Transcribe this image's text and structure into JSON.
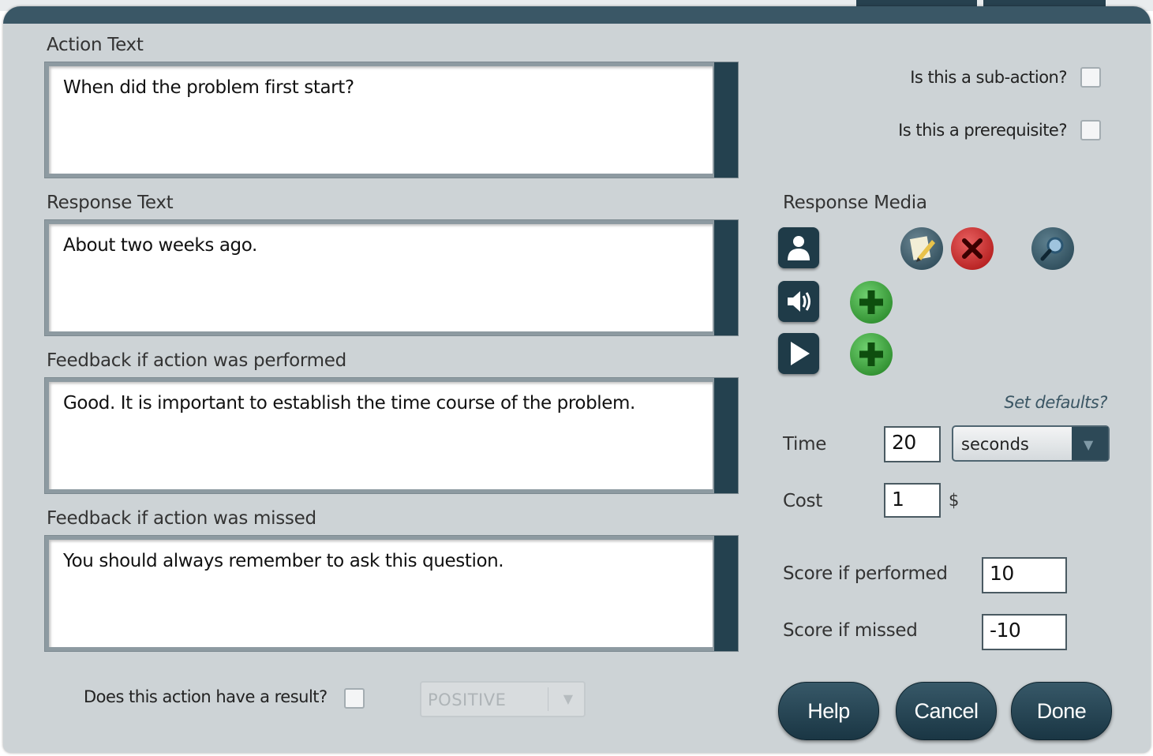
{
  "fields": {
    "action_text": {
      "label": "Action Text",
      "value": "When did the problem first start?"
    },
    "response_text": {
      "label": "Response Text",
      "value": "About two weeks ago."
    },
    "feedback_performed": {
      "label": "Feedback if action was performed",
      "value": "Good. It is important to establish the time course of the problem."
    },
    "feedback_missed": {
      "label": "Feedback if action was missed",
      "value": "You should always remember to ask this question."
    }
  },
  "options": {
    "sub_action": {
      "label": "Is this a sub-action?",
      "checked": false
    },
    "prerequisite": {
      "label": "Is this a prerequisite?",
      "checked": false
    },
    "has_result": {
      "label": "Does this action have a result?",
      "checked": false
    },
    "result_select": {
      "value": "POSITIVE",
      "disabled": true
    }
  },
  "media": {
    "label": "Response Media",
    "rows": [
      {
        "type": "person-icon",
        "actions": [
          "edit-icon",
          "delete-icon",
          "view-icon"
        ]
      },
      {
        "type": "speaker-icon",
        "actions": [
          "add-icon"
        ]
      },
      {
        "type": "play-icon",
        "actions": [
          "add-icon"
        ]
      }
    ]
  },
  "settings": {
    "set_defaults": "Set defaults?",
    "time": {
      "label": "Time",
      "value": "20",
      "unit": "seconds"
    },
    "cost": {
      "label": "Cost",
      "value": "1",
      "unit": "$"
    },
    "score_performed": {
      "label": "Score if performed",
      "value": "10"
    },
    "score_missed": {
      "label": "Score if missed",
      "value": "-10"
    }
  },
  "buttons": {
    "help": "Help",
    "cancel": "Cancel",
    "done": "Done"
  },
  "colors": {
    "panel": "#cdd3d6",
    "accent": "#24414f",
    "button": "#1f3b48",
    "add": "#2e9a2e",
    "delete": "#c41c1c"
  }
}
